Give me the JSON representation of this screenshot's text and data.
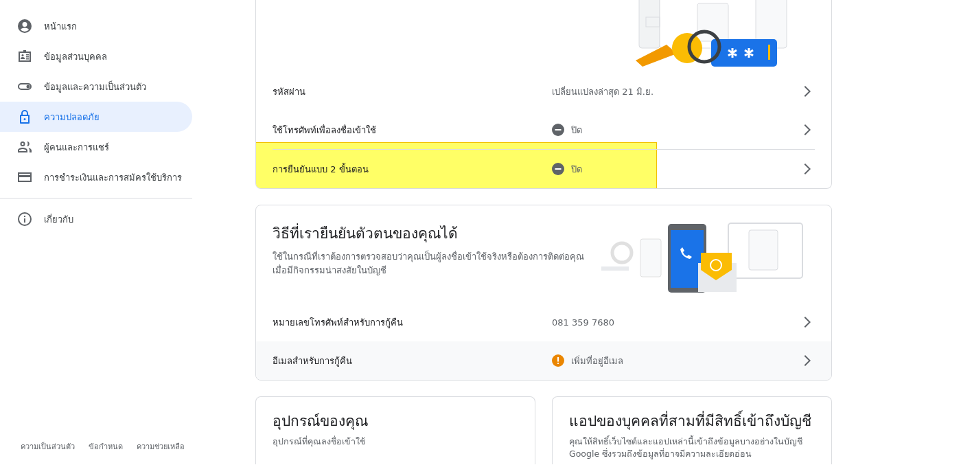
{
  "sidebar": {
    "items": [
      {
        "label": "หน้าแรก",
        "selected": false
      },
      {
        "label": "ข้อมูลส่วนบุคคล",
        "selected": false
      },
      {
        "label": "ข้อมูลและความเป็นส่วนตัว",
        "selected": false
      },
      {
        "label": "ความปลอดภัย",
        "selected": true
      },
      {
        "label": "ผู้คนและการแชร์",
        "selected": false
      },
      {
        "label": "การชำระเงินและการสมัครใช้บริการ",
        "selected": false
      }
    ],
    "secondary_items": [
      {
        "label": "เกี่ยวกับ",
        "selected": false
      }
    ],
    "footer_links": [
      "ความเป็นส่วนตัว",
      "ข้อกำหนด",
      "ความช่วยเหลือ"
    ]
  },
  "signin_card": {
    "rows": [
      {
        "kind": "plain",
        "label": "รหัสผ่าน",
        "value": "เปลี่ยนแปลงล่าสุด 21 มิ.ย.",
        "highlighted": false,
        "hovered": false
      },
      {
        "kind": "off",
        "label": "ใช้โทรศัพท์เพื่อลงชื่อเข้าใช้",
        "value": "ปิด",
        "highlighted": false,
        "hovered": false
      },
      {
        "kind": "off",
        "label": "การยืนยันแบบ 2 ขั้นตอน",
        "value": "ปิด",
        "highlighted": true,
        "hovered": false
      }
    ]
  },
  "verify_card": {
    "title": "วิธีที่เรายืนยันตัวตนของคุณได้",
    "description": "ใช้ในกรณีที่เราต้องการตรวจสอบว่าคุณเป็นผู้ลงชื่อเข้าใช้จริงหรือต้องการติดต่อคุณเมื่อมีกิจกรรมน่าสงสัยในบัญชี",
    "rows": [
      {
        "kind": "plain",
        "label": "หมายเลขโทรศัพท์สำหรับการกู้คืน",
        "value": "081 359 7680",
        "hovered": false
      },
      {
        "kind": "warning",
        "label": "อีเมลสำหรับการกู้คืน",
        "value": "เพิ่มที่อยู่อีเมล",
        "hovered": true
      }
    ]
  },
  "bottom_cards": [
    {
      "title": "อุปกรณ์ของคุณ",
      "description": "อุปกรณ์ที่คุณลงชื่อเข้าใช้"
    },
    {
      "title": "แอปของบุคคลที่สามที่มีสิทธิ์เข้าถึงบัญชี",
      "description": "คุณให้สิทธิ์เว็บไซต์และแอปเหล่านี้เข้าถึงข้อมูลบางอย่างในบัญชี Google ซึ่งรวมถึงข้อมูลที่อาจมีความละเอียดอ่อน"
    }
  ]
}
